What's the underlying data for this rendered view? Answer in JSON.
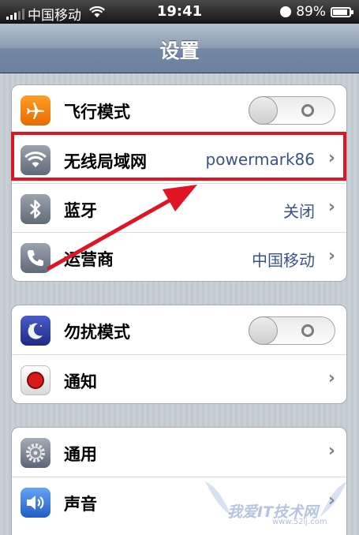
{
  "status_bar": {
    "carrier": "中国移动",
    "time": "19:41",
    "battery_text": "89%",
    "battery_level": 0.89
  },
  "nav": {
    "title": "设置"
  },
  "group1": [
    {
      "label": "飞行模式",
      "type": "toggle",
      "state": "off",
      "icon": "airplane-icon"
    },
    {
      "label": "无线局域网",
      "value": "powermark86",
      "type": "disclosure",
      "icon": "wifi-icon"
    },
    {
      "label": "蓝牙",
      "value": "关闭",
      "type": "disclosure",
      "icon": "bluetooth-icon"
    },
    {
      "label": "运营商",
      "value": "中国移动",
      "type": "disclosure",
      "icon": "phone-icon"
    }
  ],
  "group2": [
    {
      "label": "勿扰模式",
      "type": "toggle",
      "state": "off",
      "icon": "moon-icon"
    },
    {
      "label": "通知",
      "type": "disclosure",
      "icon": "notification-icon"
    }
  ],
  "group3": [
    {
      "label": "通用",
      "type": "disclosure",
      "icon": "gear-icon"
    },
    {
      "label": "声音",
      "type": "disclosure",
      "icon": "speaker-icon"
    }
  ],
  "watermark": {
    "text": "我爱IT技术网",
    "url": "www.52ij.com"
  },
  "colors": {
    "highlight": "#e01422",
    "value_text": "#385487",
    "nav_bar": "#6d82a0"
  }
}
